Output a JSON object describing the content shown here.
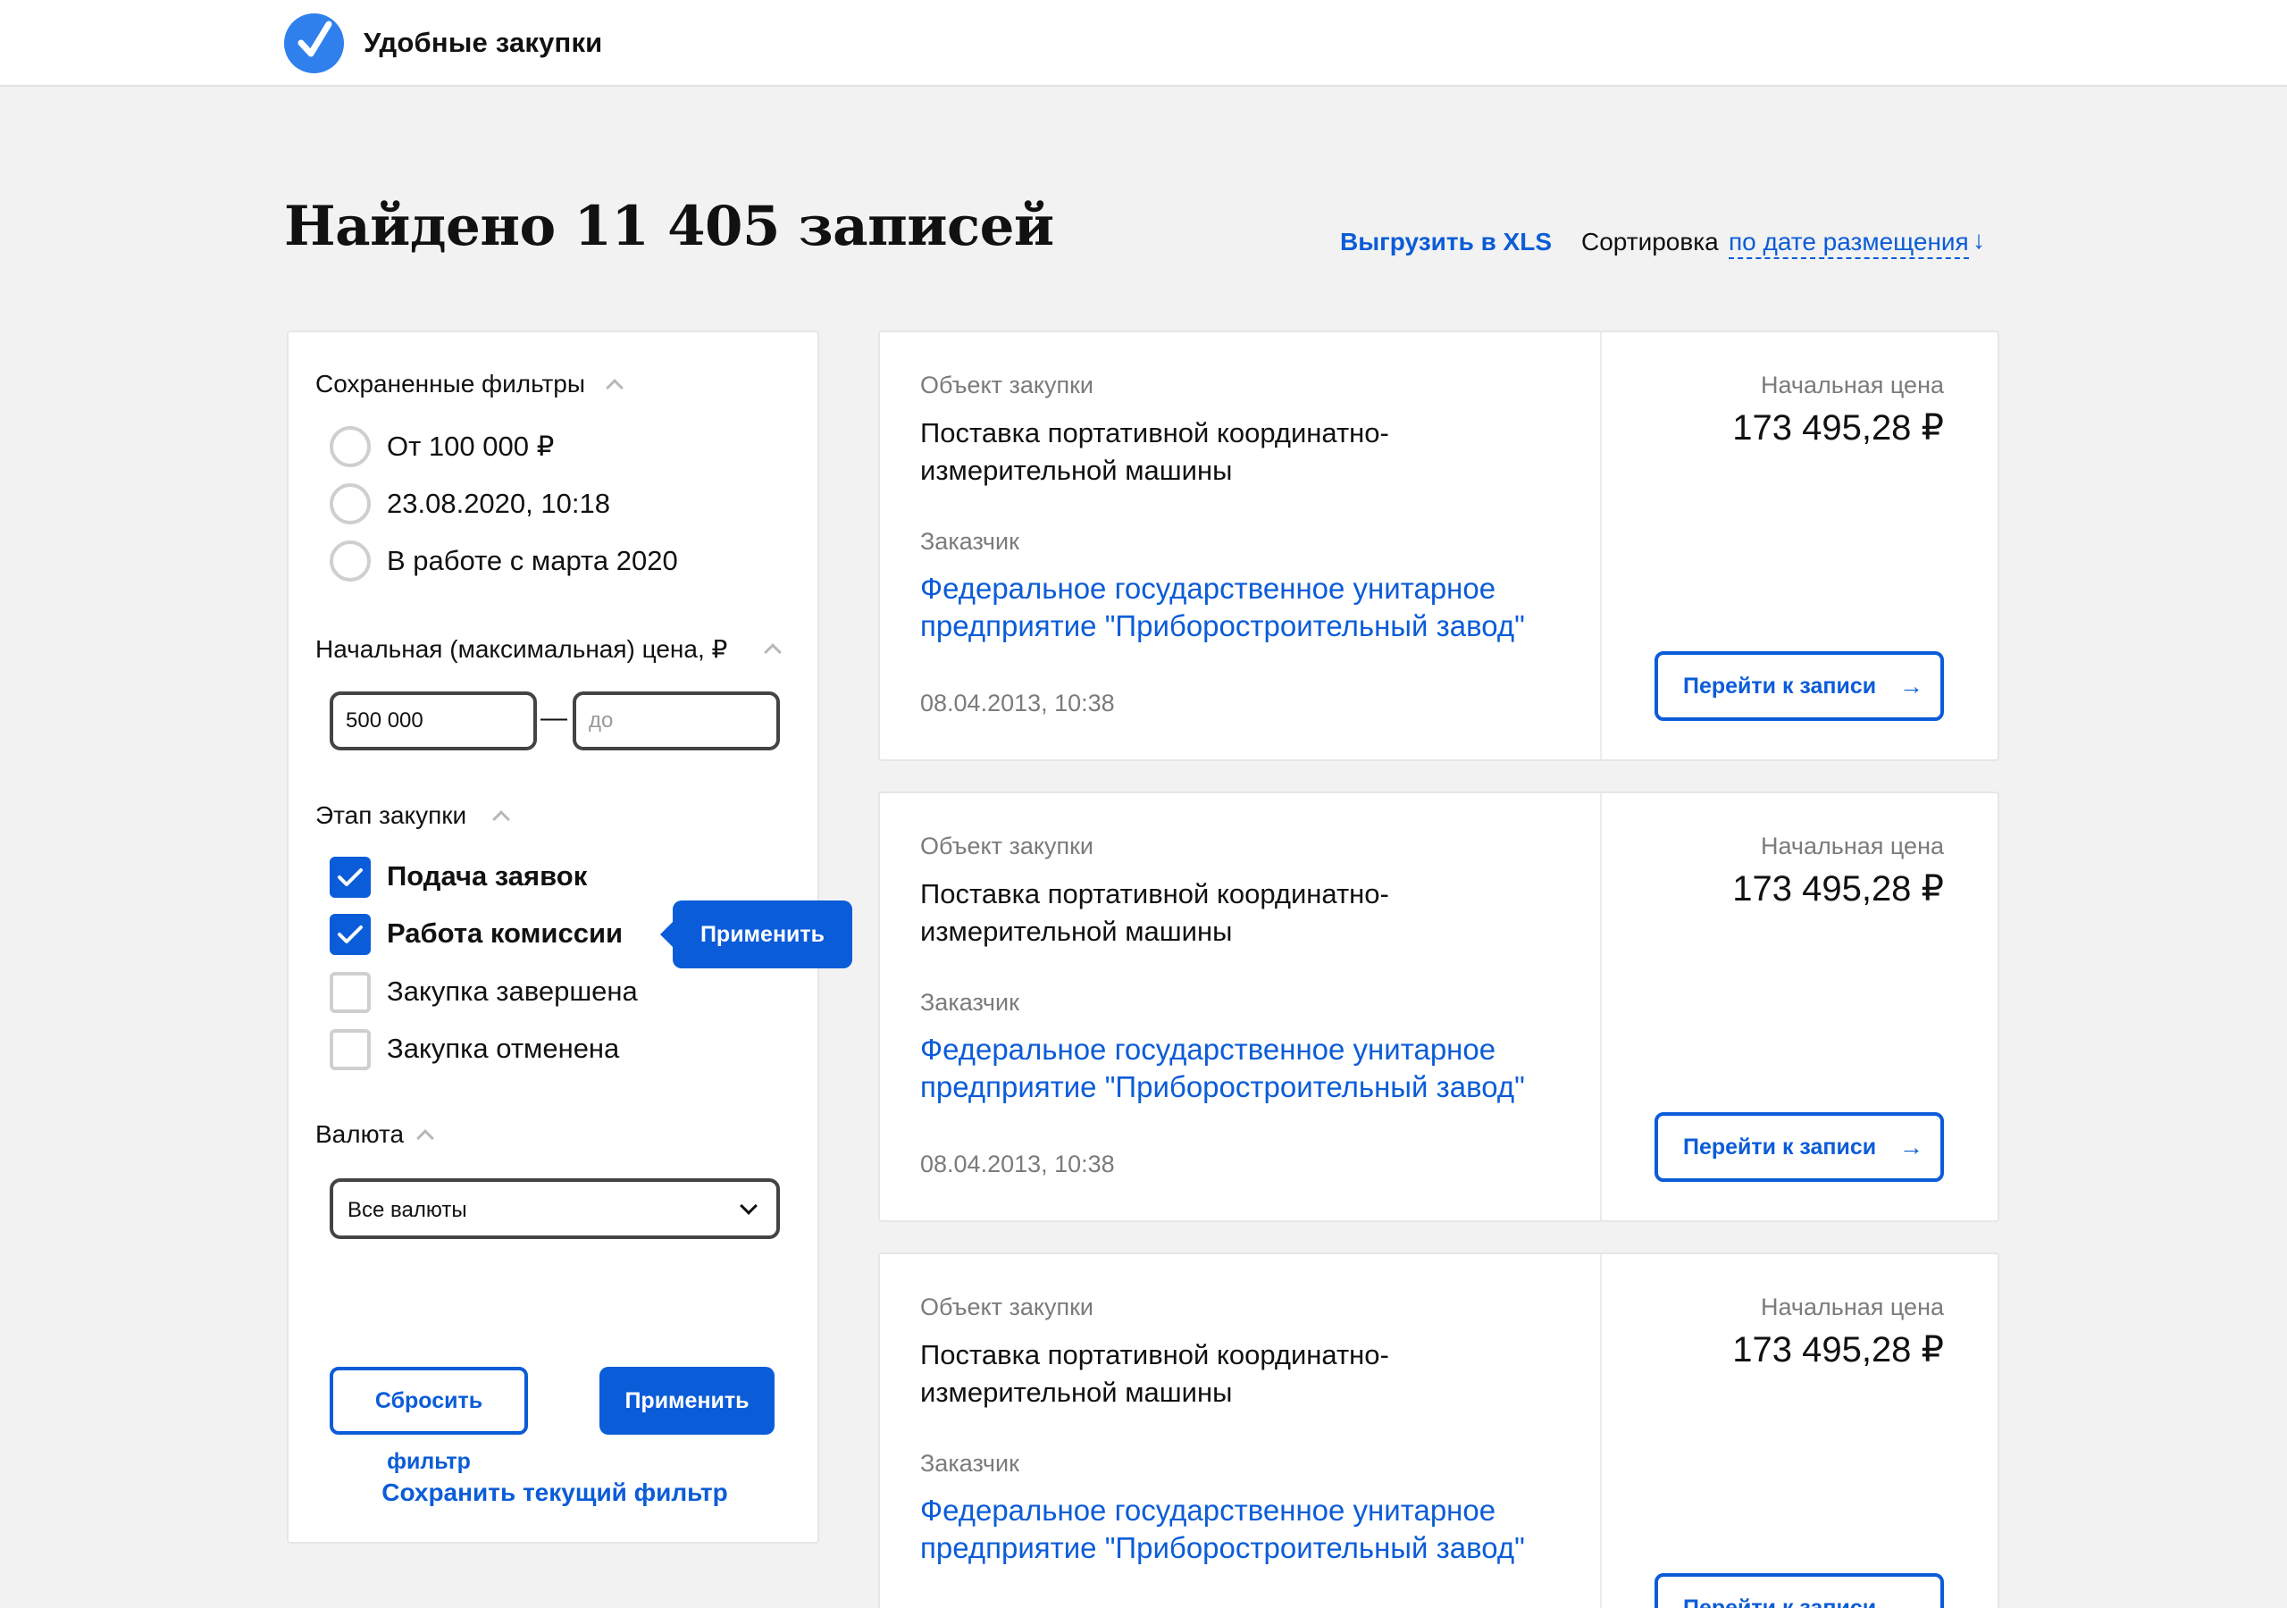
{
  "header": {
    "brand": "Удобные закупки",
    "logo_icon": "check-circle-icon",
    "accent": "#2f80ed"
  },
  "toolbar": {
    "title": "Найдено 11 405 записей",
    "export_label": "Выгрузить в XLS",
    "sort_label": "Сортировка",
    "sort_value": "по дате размещения",
    "sort_arrow": "↓"
  },
  "filters": {
    "saved": {
      "title": "Сохраненные фильтры",
      "items": [
        {
          "label": "От 100 000 ₽",
          "selected": false
        },
        {
          "label": "23.08.2020, 10:18",
          "selected": false
        },
        {
          "label": "В работе с марта 2020",
          "selected": false
        }
      ]
    },
    "price": {
      "title": "Начальная (максимальная) цена, ₽",
      "from_value": "500 000",
      "to_placeholder": "до",
      "separator": "—"
    },
    "stage": {
      "title": "Этап закупки",
      "items": [
        {
          "label": "Подача заявок",
          "checked": true
        },
        {
          "label": "Работа комиссии",
          "checked": true
        },
        {
          "label": "Закупка завершена",
          "checked": false
        },
        {
          "label": "Закупка отменена",
          "checked": false
        }
      ]
    },
    "currency": {
      "title": "Валюта",
      "selected": "Все валюты"
    },
    "reset_label": "Сбросить фильтр",
    "apply_label": "Применить",
    "save_label": "Сохранить текущий фильтр",
    "tooltip_apply_label": "Применить"
  },
  "results": [
    {
      "object_label": "Объект закупки",
      "object": "Поставка портативной координатно-измерительной машины",
      "customer_label": "Заказчик",
      "customer": "Федеральное государственное унитарное предприятие \"Приборостроительный завод\"",
      "date": "08.04.2013, 10:38",
      "price_label": "Начальная цена",
      "price": "173 495,28 ₽",
      "button_label": "Перейти к записи"
    },
    {
      "object_label": "Объект закупки",
      "object": "Поставка портативной координатно-измерительной машины",
      "customer_label": "Заказчик",
      "customer": "Федеральное государственное унитарное предприятие \"Приборостроительный завод\"",
      "date": "08.04.2013, 10:38",
      "price_label": "Начальная цена",
      "price": "173 495,28 ₽",
      "button_label": "Перейти к записи"
    },
    {
      "object_label": "Объект закупки",
      "object": "Поставка портативной координатно-измерительной машины",
      "customer_label": "Заказчик",
      "customer": "Федеральное государственное унитарное предприятие \"Приборостроительный завод\"",
      "date": "",
      "price_label": "Начальная цена",
      "price": "173 495,28 ₽",
      "button_label": "Перейти к записи"
    }
  ]
}
